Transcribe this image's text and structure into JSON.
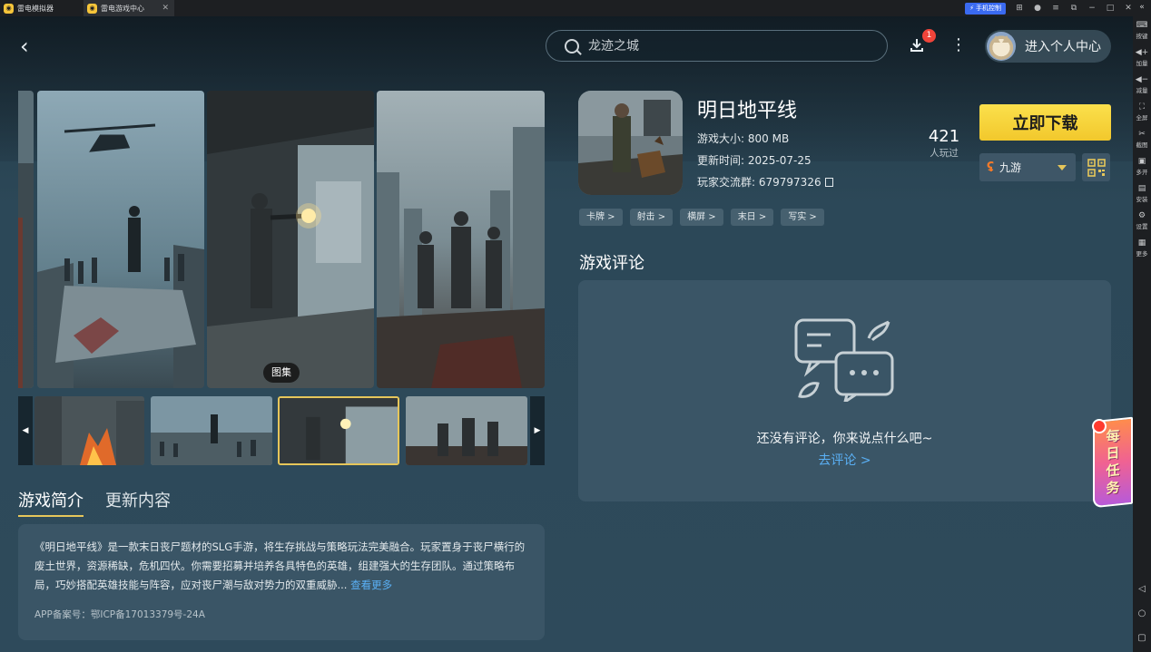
{
  "titlebar": {
    "tabs": [
      {
        "label": "雷电模拟器"
      },
      {
        "label": "雷电游戏中心"
      }
    ],
    "phone_control": "手机控制"
  },
  "sidebar": {
    "items": [
      {
        "label": "按键",
        "icon": "keyboard-icon"
      },
      {
        "label": "加量",
        "icon": "volume-up-icon"
      },
      {
        "label": "减量",
        "icon": "volume-down-icon"
      },
      {
        "label": "全屏",
        "icon": "fullscreen-icon"
      },
      {
        "label": "截图",
        "icon": "scissors-icon"
      },
      {
        "label": "多开",
        "icon": "multi-instance-icon"
      },
      {
        "label": "安装",
        "icon": "install-icon"
      },
      {
        "label": "设置",
        "icon": "gear-icon"
      },
      {
        "label": "更多",
        "icon": "more-icon"
      }
    ]
  },
  "header": {
    "search_placeholder": "龙迹之城",
    "download_badge": "1",
    "user_center_label": "进入个人中心"
  },
  "gallery": {
    "tag": "图集"
  },
  "game": {
    "title": "明日地平线",
    "size_label": "游戏大小:",
    "size_value": "800 MB",
    "update_label": "更新时间:",
    "update_value": "2025-07-25",
    "group_label": "玩家交流群:",
    "group_value": "679797326",
    "players_count": "421",
    "players_label": "人玩过",
    "download_button": "立即下载",
    "channel_name": "九游",
    "tags": [
      "卡牌 >",
      "射击 >",
      "横屏 >",
      "末日 >",
      "写实 >"
    ]
  },
  "tabs": [
    {
      "label": "游戏简介",
      "active": true
    },
    {
      "label": "更新内容",
      "active": false
    }
  ],
  "intro": {
    "text": "《明日地平线》是一款末日丧尸题材的SLG手游，将生存挑战与策略玩法完美融合。玩家置身于丧尸横行的废土世界，资源稀缺，危机四伏。你需要招募并培养各具特色的英雄，组建强大的生存团队。通过策略布局，巧妙搭配英雄技能与阵容，应对丧尸潮与敌对势力的双重威胁...",
    "more_link": "查看更多",
    "icp": "APP备案号：鄂ICP备17013379号-24A"
  },
  "comments": {
    "title": "游戏评论",
    "empty_text": "还没有评论，你来说点什么吧~",
    "go_comment": "去评论 >"
  },
  "daily_task": {
    "chars": [
      "每",
      "日",
      "任",
      "务"
    ]
  },
  "colors": {
    "accent_yellow": "#f2c82c",
    "link_blue": "#5ab0f5",
    "panel": "#3a5566",
    "badge_red": "#f0443a"
  }
}
